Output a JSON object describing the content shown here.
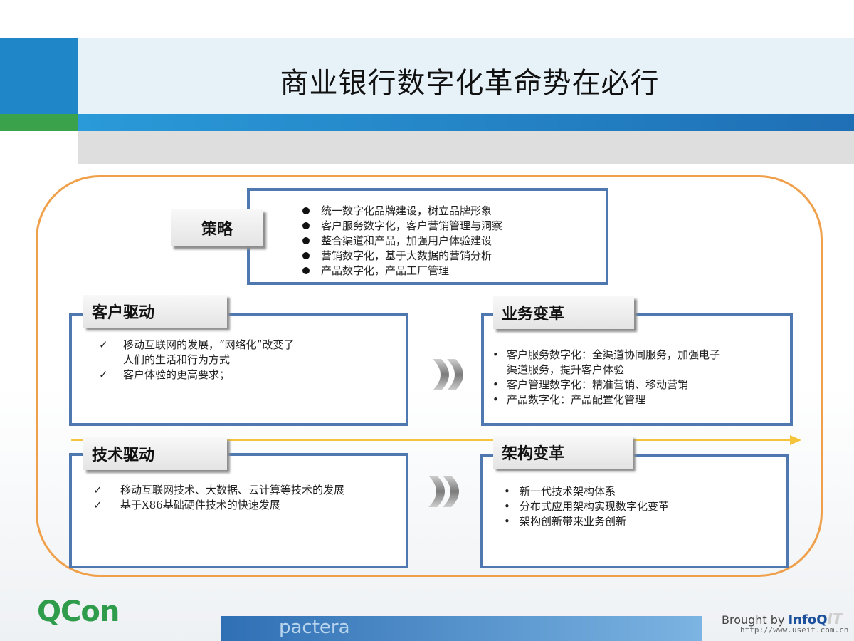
{
  "title": "商业银行数字化革命势在必行",
  "strategy": {
    "label": "策略",
    "items": [
      "统一数字化品牌建设，树立品牌形象",
      "客户服务数字化，客户营销管理与洞察",
      "整合渠道和产品，加强用户体验建设",
      "营销数字化，基于大数据的营销分析",
      "产品数字化，产品工厂管理"
    ]
  },
  "customer_drive": {
    "label": "客户驱动",
    "items": [
      {
        "line1": "移动互联网的发展，“网络化”改变了",
        "line2": "人们的生活和行为方式"
      },
      {
        "line1": "客户体验的更高要求；",
        "line2": ""
      }
    ]
  },
  "business_change": {
    "label": "业务变革",
    "items": [
      {
        "line1": "客户服务数字化：全渠道协同服务，加强电子",
        "line2": "渠道服务，提升客户体验"
      },
      {
        "line1": "客户管理数字化：精准营销、移动营销",
        "line2": ""
      },
      {
        "line1": "产品数字化：产品配置化管理",
        "line2": ""
      }
    ]
  },
  "tech_drive": {
    "label": "技术驱动",
    "items": [
      "移动互联网技术、大数据、云计算等技术的发展",
      "基于X86基础硬件技术的快速发展"
    ]
  },
  "arch_change": {
    "label": "架构变革",
    "items": [
      "新一代技术架构体系",
      "分布式应用架构实现数字化变革",
      "架构创新带来业务创新"
    ]
  },
  "footer": {
    "qcon": "QCon",
    "pactera": "pactera",
    "brought_by": "Brought by",
    "infoq": "InfoQ",
    "watermark": "IT",
    "url": "http://www.useit.com.cn"
  },
  "colors": {
    "frame": "#f0a04a",
    "box_border": "#4f78b0",
    "timeline": "#f5c43b",
    "header_blue": "#1f86c8",
    "header_green": "#3aa24a"
  }
}
